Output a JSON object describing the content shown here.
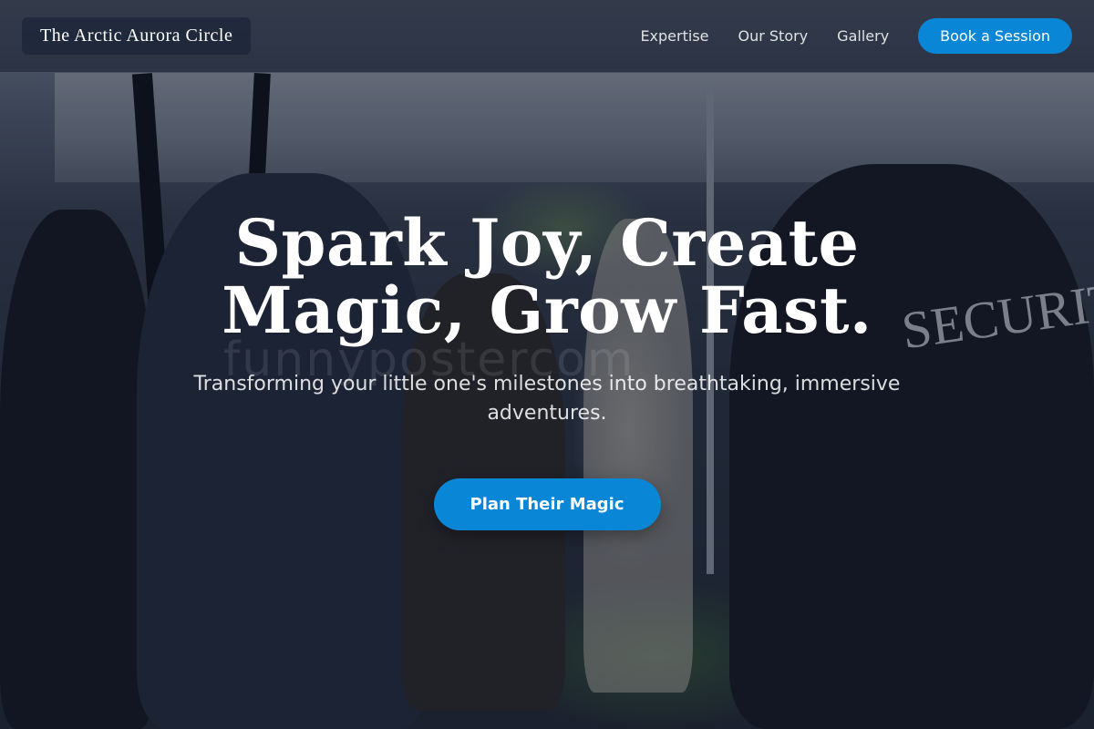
{
  "brand": {
    "name": "The Arctic Aurora Circle"
  },
  "nav": {
    "items": [
      {
        "label": "Expertise"
      },
      {
        "label": "Our Story"
      },
      {
        "label": "Gallery"
      }
    ],
    "cta_label": "Book a Session"
  },
  "hero": {
    "headline": "Spark Joy, Create Magic, Grow Fast.",
    "subheadline": "Transforming your little one's milestones into breathtaking, immersive adventures.",
    "cta_label": "Plan Their Magic",
    "watermark": "funnypostercom",
    "photo_sign": "SECURITY"
  },
  "colors": {
    "accent": "#0a86d6",
    "header_bg": "#161e2e",
    "text": "#ffffff"
  }
}
